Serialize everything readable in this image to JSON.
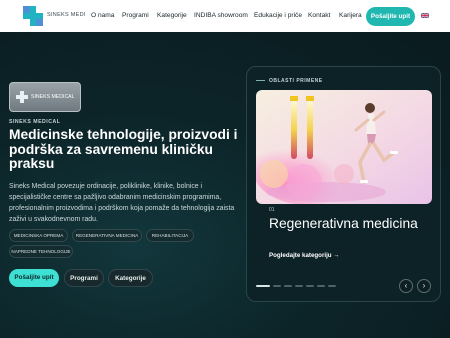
{
  "header": {
    "brand": "SINEKS MEDICAL",
    "nav": [
      "O nama",
      "Programi",
      "Kategorije",
      "INDIBA showroom",
      "Edukacije i priče",
      "Kontakt",
      "Karijera"
    ],
    "cta_label": "Pošaljite upit",
    "language_flag": "uk-flag-icon"
  },
  "hero": {
    "logo_text": "SINEKS MEDICAL",
    "eyebrow": "SINEKS MEDICAL",
    "title": "Medicinske tehnologije, proizvodi i podrška za savremenu kliničku praksu",
    "description": "Sineks Medical povezuje ordinacije, poliklinike, klinike, bolnice i specijalističke centre sa pažljivo odabranim medicinskim programima, profesionalnim proizvodima i podrškom koja pomaže da tehnologija zaista zaživi u svakodnevnom radu.",
    "tags": [
      "MEDICINSKA OPREMA",
      "REGENERATIVNA MEDICINA",
      "REHABILITACIJA",
      "NAPREDNE TEHNOLOGIJE"
    ],
    "buttons": {
      "primary": "Pošaljite upit",
      "programs": "Programi",
      "categories": "Kategorije"
    }
  },
  "card": {
    "label": "OBLASTI PRIMENE",
    "number": "01",
    "title": "Regenerativna medicina",
    "link": "Pogledajte kategoriju →",
    "slides_total": 7,
    "active_slide": 1,
    "prev_icon": "chevron-left-icon",
    "next_icon": "chevron-right-icon"
  },
  "colors": {
    "accent": "#20b7b0",
    "accent_light": "#3fe0d4",
    "background": "#0b1e22"
  }
}
